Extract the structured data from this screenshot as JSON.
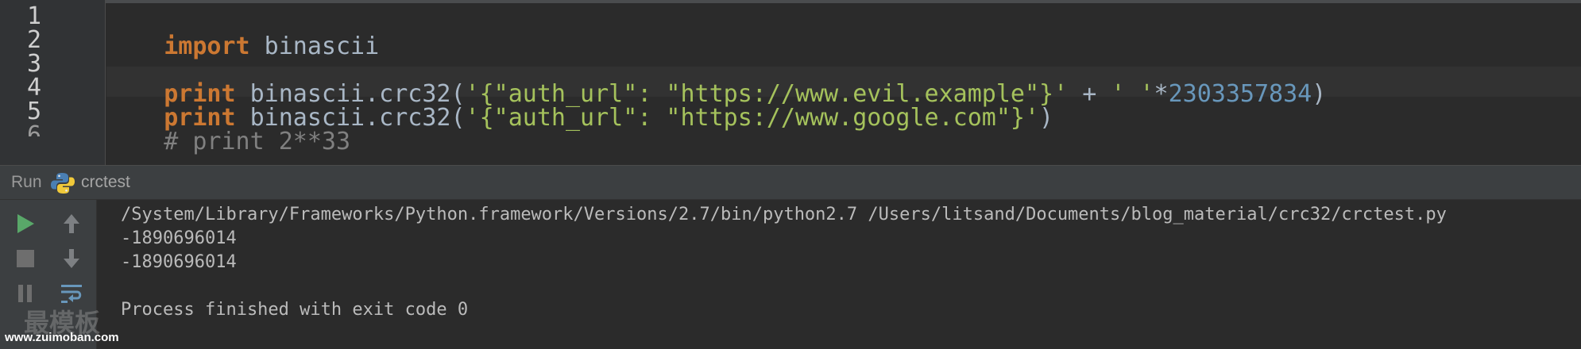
{
  "editor": {
    "line_numbers": [
      "1",
      "2",
      "3",
      "4",
      "5"
    ],
    "line1": {
      "kw": "import",
      "rest": " binascii"
    },
    "line3": {
      "kw": "print",
      "pre": " binascii.crc32(",
      "str1": "'{\"auth_url\": \"https://www.evil.example\"}'",
      "mid": " + ",
      "str2": "' '",
      "op": "*",
      "num": "2303357834",
      "close": ")"
    },
    "line4": {
      "kw": "print",
      "pre": " binascii.crc32(",
      "str1": "'{\"auth_url\": \"https://www.google.com\"}'",
      "close": ")"
    },
    "line5": {
      "comment": "# print 2**33"
    }
  },
  "run_panel": {
    "label": "Run",
    "config_name": "crctest",
    "config_icon": "python-icon"
  },
  "toolbar": {
    "icons": [
      "rerun-icon",
      "stop-icon",
      "pause-icon",
      "scroll-up-icon",
      "scroll-down-icon",
      "soft-wrap-icon"
    ]
  },
  "console": {
    "lines": [
      "/System/Library/Frameworks/Python.framework/Versions/2.7/bin/python2.7 /Users/litsand/Documents/blog_material/crc32/crctest.py",
      "-1890696014",
      "-1890696014",
      "",
      "Process finished with exit code 0"
    ]
  },
  "watermark": {
    "url": "www.zuimoban.com"
  },
  "colors": {
    "keyword": "#cc7832",
    "string": "#a5c25c",
    "number": "#6897bb",
    "comment": "#808080",
    "run_green": "#59a869"
  }
}
